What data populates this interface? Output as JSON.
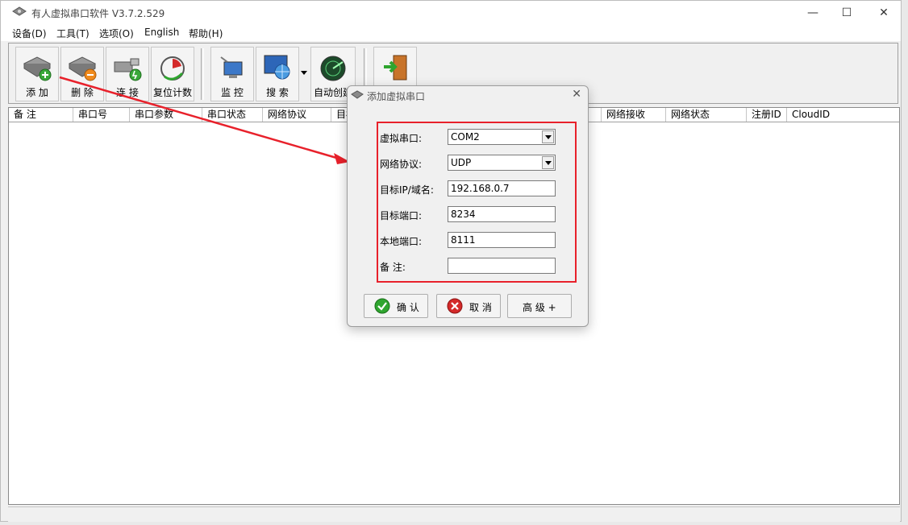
{
  "window": {
    "title": "有人虚拟串口软件 V3.7.2.529",
    "controls": [
      "—",
      "☐",
      "✕"
    ]
  },
  "menu": [
    "设备(D)",
    "工具(T)",
    "选项(O)",
    "English",
    "帮助(H)"
  ],
  "toolbar": {
    "add": "添 加",
    "delete": "删 除",
    "connect": "连 接",
    "reset_count": "复位计数",
    "monitor": "监 控",
    "search": "搜 索",
    "auto_create": "自动创建"
  },
  "table": {
    "columns": [
      "备 注",
      "串口号",
      "串口参数",
      "串口状态",
      "网络协议",
      "目标IP",
      "",
      "",
      "",
      "网络接收",
      "网络状态",
      "注册ID",
      "CloudID"
    ]
  },
  "dialog": {
    "title": "添加虚拟串口",
    "fields": {
      "virtual_port": {
        "label": "虚拟串口:",
        "value": "COM2"
      },
      "protocol": {
        "label": "网络协议:",
        "value": "UDP"
      },
      "target_ip": {
        "label": "目标IP/域名:",
        "value": "192.168.0.7"
      },
      "target_port": {
        "label": "目标端口:",
        "value": "8234"
      },
      "local_port": {
        "label": "本地端口:",
        "value": "8111"
      },
      "remark": {
        "label": "备 注:",
        "value": ""
      }
    },
    "buttons": {
      "ok": "确 认",
      "cancel": "取 消",
      "advanced": "高 级 +"
    }
  },
  "colors": {
    "annotation_red": "#e8212b",
    "ok_green": "#2fa52f",
    "cancel_red": "#d42a2a"
  }
}
